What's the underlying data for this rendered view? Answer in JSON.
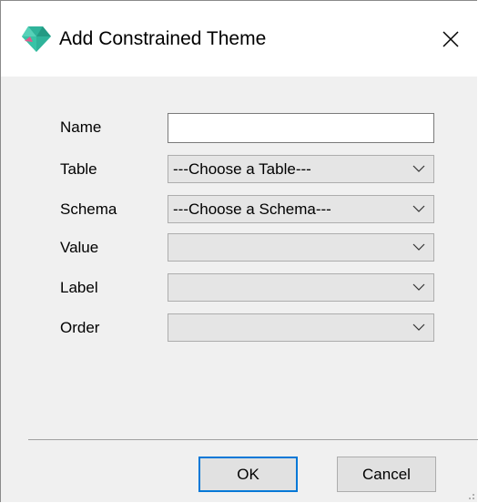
{
  "window": {
    "title": "Add Constrained Theme",
    "icon": "app-gem-icon",
    "close_icon": "close-icon"
  },
  "form": {
    "name": {
      "label": "Name",
      "value": "",
      "placeholder": ""
    },
    "table": {
      "label": "Table",
      "selected": "---Choose a Table---"
    },
    "schema": {
      "label": "Schema",
      "selected": "---Choose a Schema---"
    },
    "value": {
      "label": "Value",
      "selected": ""
    },
    "label": {
      "label": "Label",
      "selected": ""
    },
    "order": {
      "label": "Order",
      "selected": ""
    }
  },
  "buttons": {
    "ok": "OK",
    "cancel": "Cancel"
  },
  "colors": {
    "accent": "#0078d7",
    "icon_teal": "#3cc0a8",
    "icon_pink": "#e05a8a"
  }
}
